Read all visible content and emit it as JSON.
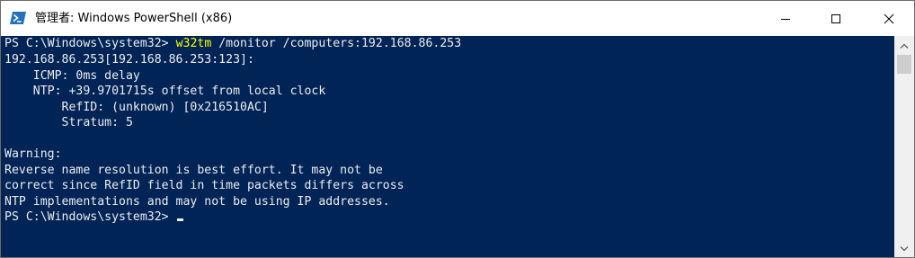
{
  "window": {
    "title": "管理者: Windows PowerShell (x86)",
    "colors": {
      "console_background": "#012456",
      "console_text": "#eeedf0",
      "command_highlight": "#ffff00",
      "titlebar_background": "#ffffff"
    },
    "icons": {
      "app": "powershell-icon",
      "minimize": "minimize-icon",
      "maximize": "maximize-icon",
      "close": "close-icon",
      "scroll_up": "chevron-up-icon",
      "scroll_down": "chevron-down-icon"
    }
  },
  "console": {
    "prompt1": "PS C:\\Windows\\system32> ",
    "command_name": "w32tm",
    "command_args": " /monitor /computers:192.168.86.253",
    "output_lines": [
      "192.168.86.253[192.168.86.253:123]:",
      "    ICMP: 0ms delay",
      "    NTP: +39.9701715s offset from local clock",
      "        RefID: (unknown) [0x216510AC]",
      "        Stratum: 5",
      "",
      "Warning:",
      "Reverse name resolution is best effort. It may not be",
      "correct since RefID field in time packets differs across",
      "NTP implementations and may not be using IP addresses."
    ],
    "prompt2": "PS C:\\Windows\\system32> "
  }
}
